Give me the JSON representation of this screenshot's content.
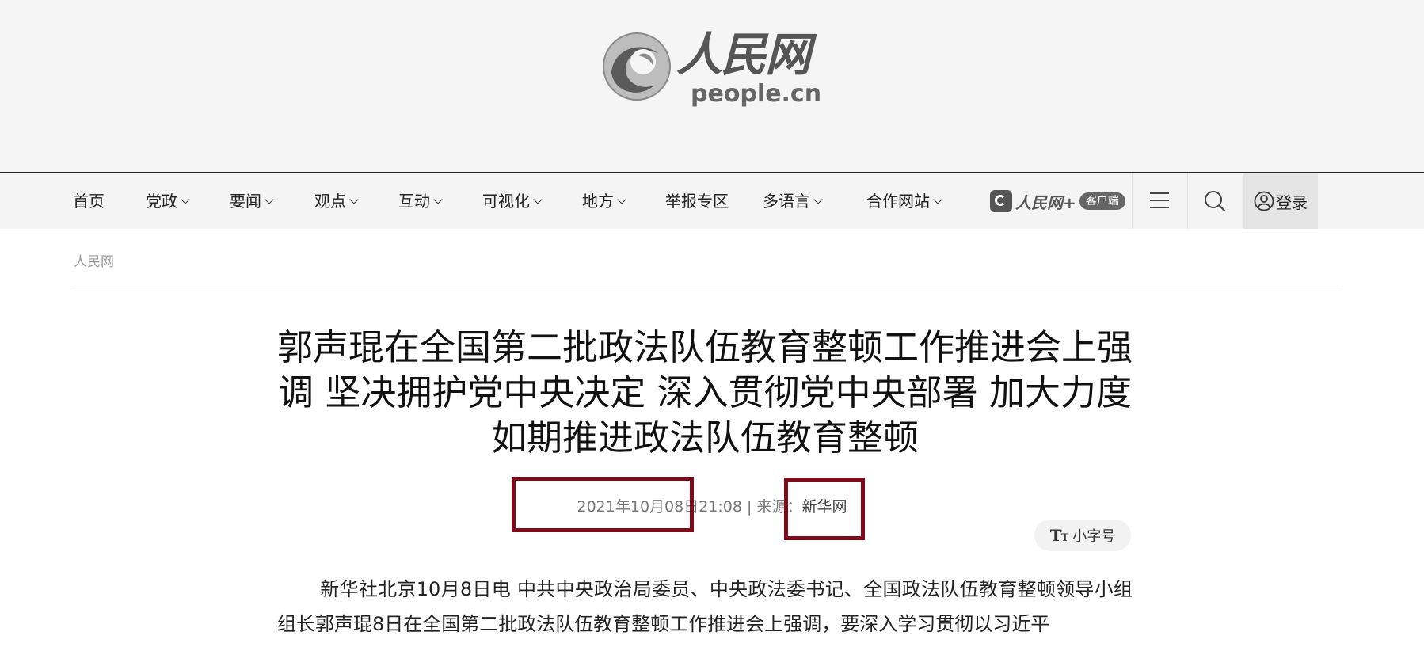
{
  "header": {
    "logo_cn": "人民网",
    "logo_en": "people.cn"
  },
  "nav": {
    "items": [
      {
        "label": "首页",
        "dropdown": false
      },
      {
        "label": "党政",
        "dropdown": true
      },
      {
        "label": "要闻",
        "dropdown": true
      },
      {
        "label": "观点",
        "dropdown": true
      },
      {
        "label": "互动",
        "dropdown": true
      },
      {
        "label": "可视化",
        "dropdown": true
      },
      {
        "label": "地方",
        "dropdown": true
      },
      {
        "label": "举报专区",
        "dropdown": false
      },
      {
        "label": "多语言",
        "dropdown": true
      },
      {
        "label": "合作网站",
        "dropdown": true
      }
    ],
    "app_name": "人民网+",
    "app_badge": "客户端",
    "menu_icon": "hamburger-menu-icon",
    "search_icon": "search-icon",
    "login_label": "登录",
    "login_icon": "user-circle-icon"
  },
  "breadcrumb": {
    "label": "人民网"
  },
  "article": {
    "title": "郭声琨在全国第二批政法队伍教育整顿工作推进会上强调 坚决拥护党中央决定 深入贯彻党中央部署 加大力度如期推进政法队伍教育整顿",
    "datetime": "2021年10月08日21:08",
    "separator": "|",
    "source_prefix": "来源：",
    "source": "新华网",
    "font_size_toggle": "小字号",
    "body_paragraph": "新华社北京10月8日电 中共中央政治局委员、中央政法委书记、全国政法队伍教育整顿领导小组组长郭声琨8日在全国第二批政法队伍教育整顿工作推进会上强调，要深入学习贯彻以习近平"
  },
  "colors": {
    "highlight_border": "#7d0b1a",
    "logo_band_bg": "#f5f5f5",
    "nav_bg": "#f4f4f4",
    "login_bg": "#e4e4e4"
  }
}
